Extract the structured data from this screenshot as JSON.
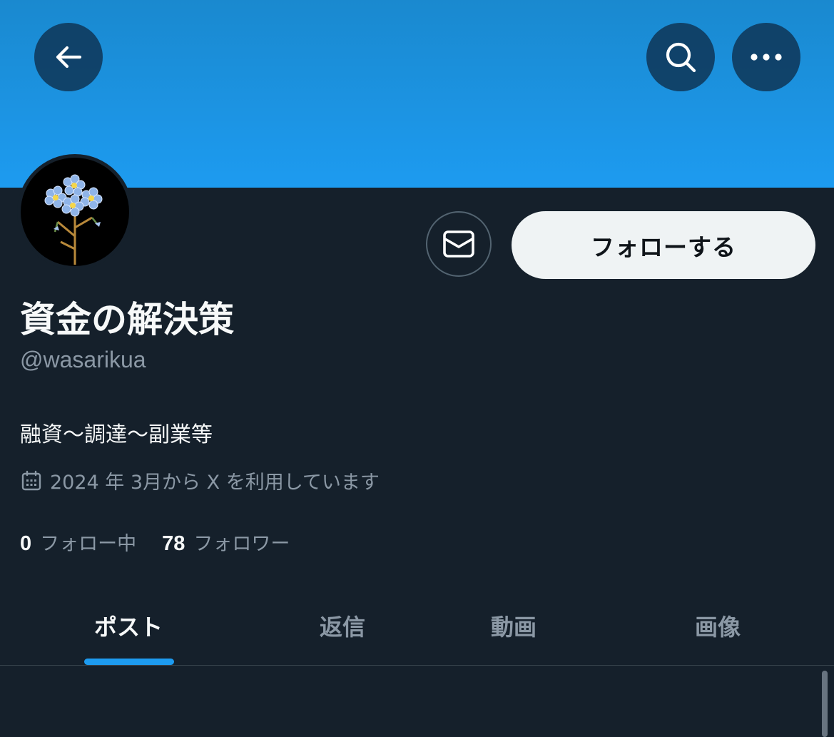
{
  "profile": {
    "display_name": "資金の解決策",
    "handle": "@wasarikua",
    "bio": "融資〜調達〜副業等",
    "joined": "2024 年 3月から X を利用しています",
    "following_count": "0",
    "following_label": "フォロー中",
    "followers_count": "78",
    "followers_label": "フォロワー"
  },
  "actions": {
    "follow_label": "フォローする"
  },
  "tabs": [
    {
      "label": "ポスト",
      "active": true
    },
    {
      "label": "返信",
      "active": false
    },
    {
      "label": "動画",
      "active": false
    },
    {
      "label": "画像",
      "active": false
    }
  ],
  "colors": {
    "banner": "#1d9bf0",
    "background": "#15202b",
    "accent": "#1d9bf0",
    "secondary_text": "#8b98a5"
  },
  "icons": {
    "back": "arrow-left-icon",
    "search": "search-icon",
    "more": "more-horizontal-icon",
    "message": "envelope-icon",
    "calendar": "calendar-icon"
  }
}
